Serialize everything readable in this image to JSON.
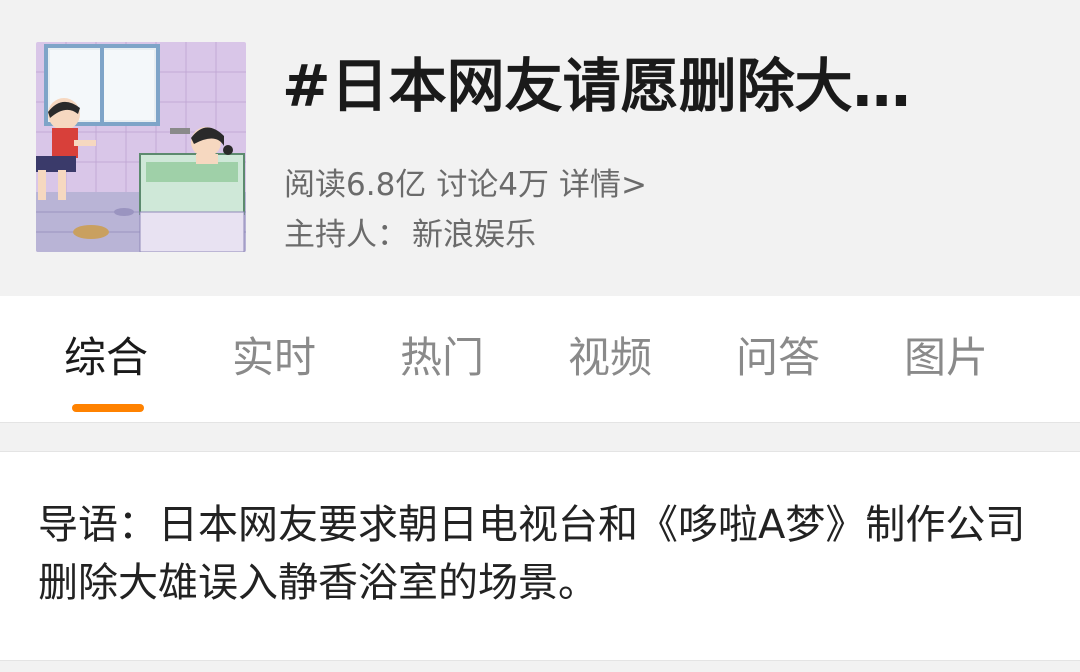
{
  "topic": {
    "title": "#日本网友请愿删除大…",
    "cover_image": "doraemon-bath-scene-thumbnail"
  },
  "stats": {
    "reads": "阅读6.8亿",
    "discussions": "讨论4万",
    "details": "详情>"
  },
  "host": {
    "label": "主持人：",
    "name": "新浪娱乐"
  },
  "tabs": [
    {
      "label": "综合",
      "active": true
    },
    {
      "label": "实时",
      "active": false
    },
    {
      "label": "热门",
      "active": false
    },
    {
      "label": "视频",
      "active": false
    },
    {
      "label": "问答",
      "active": false
    },
    {
      "label": "图片",
      "active": false
    }
  ],
  "intro": {
    "text": "导语：日本网友要求朝日电视台和《哆啦A梦》制作公司删除大雄误入静香浴室的场景。"
  },
  "colors": {
    "accent": "#ff8200",
    "background": "#f2f2f2",
    "text_primary": "#1a1a1a",
    "text_secondary": "#6b6b6b"
  }
}
